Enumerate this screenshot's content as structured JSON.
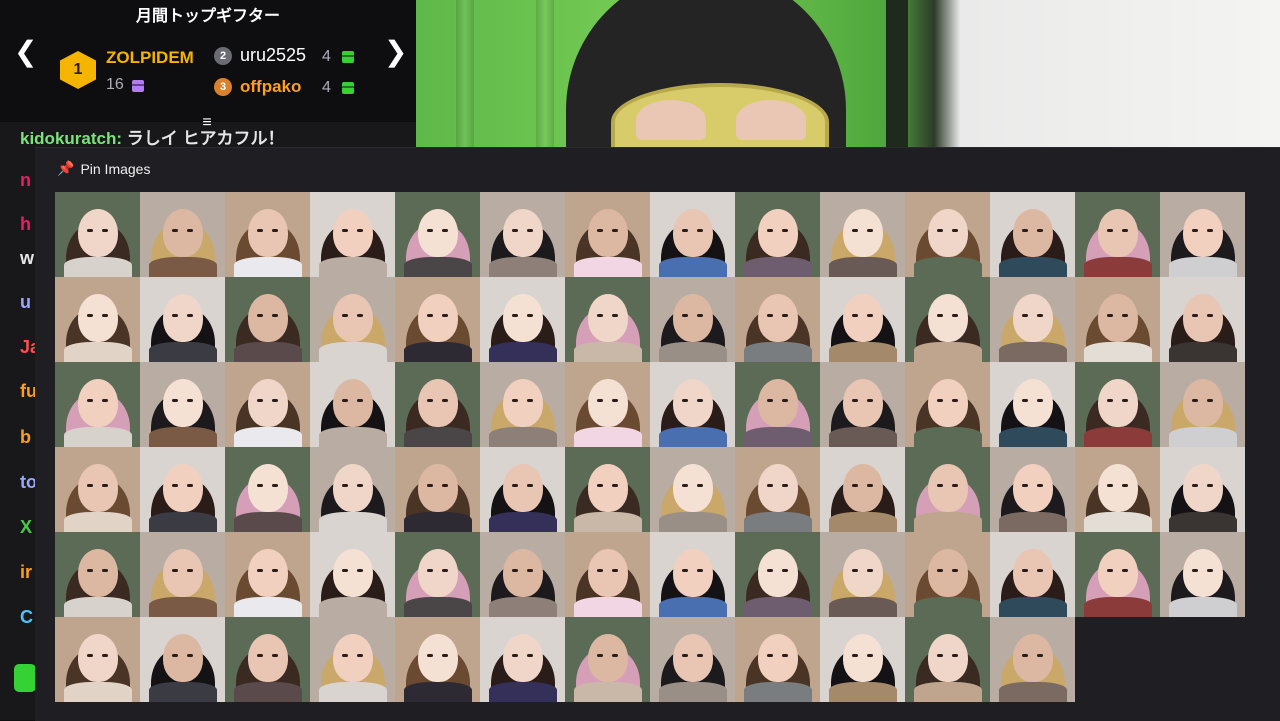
{
  "gifters": {
    "title": "月間トップギフター",
    "first": {
      "rank": "1",
      "name": "ZOLPIDEM",
      "count": "16"
    },
    "second": {
      "rank": "2",
      "name": "uru2525",
      "count": "4"
    },
    "third": {
      "rank": "3",
      "name": "offpako",
      "count": "4"
    },
    "prev_arrow": "❮",
    "next_arrow": "❯"
  },
  "chat": {
    "top_line_user": "kidokuratch:",
    "top_line_text": " ラしイ ヒアカフル！",
    "fragments": [
      {
        "text": "n",
        "color": "#e91e63"
      },
      {
        "text": "h",
        "color": "#e91e63"
      },
      {
        "text": "w",
        "color": "#e6e6e6"
      },
      {
        "text": "u",
        "color": "#9aa7ff"
      },
      {
        "text": "Ja",
        "color": "#ff4d4d"
      },
      {
        "text": "fu",
        "color": "#ff9f1c"
      },
      {
        "text": "b",
        "color": "#ff9f1c"
      },
      {
        "text": "to",
        "color": "#9aa7ff"
      },
      {
        "text": "X",
        "color": "#46c946"
      },
      {
        "text": "ir",
        "color": "#ff9f1c"
      },
      {
        "text": "C",
        "color": "#4fc3f7"
      }
    ]
  },
  "pin_panel": {
    "title": "Pin Images",
    "icon": "pushpin-icon",
    "image_count": 82
  },
  "colors": {
    "accent_gold": "#f5b400",
    "gift_green": "#35d235",
    "gift_purple": "#b57bf5",
    "pin_icon": "#e91e63"
  }
}
